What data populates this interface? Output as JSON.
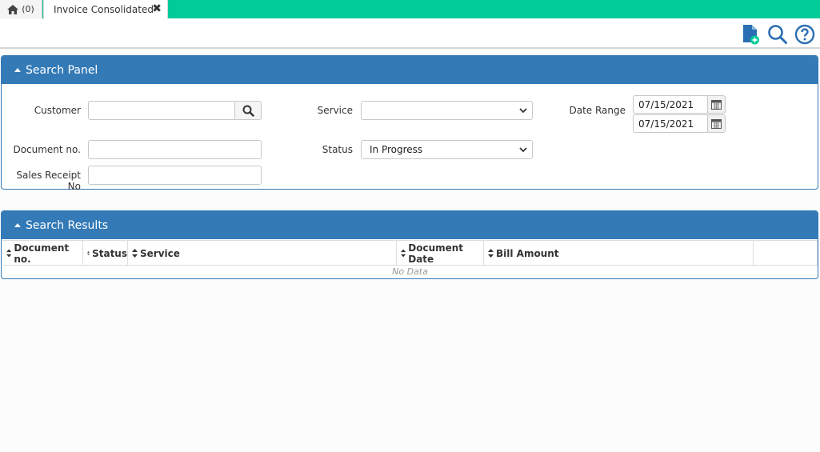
{
  "tabs": {
    "home_count": "(0)",
    "active_label": "Invoice Consolidated",
    "close_glyph": "✖"
  },
  "toolbar": {
    "icons": [
      "new-document-icon",
      "search-icon",
      "help-icon"
    ]
  },
  "search_panel": {
    "title": "Search Panel",
    "customer_label": "Customer",
    "customer_value": "",
    "document_no_label": "Document no.",
    "document_no_value": "",
    "sales_receipt_label": "Sales Receipt No",
    "sales_receipt_value": "",
    "service_label": "Service",
    "service_value": "",
    "status_label": "Status",
    "status_value": "In Progress",
    "date_range_label": "Date Range",
    "date_from": "07/15/2021",
    "date_to": "07/15/2021"
  },
  "results_panel": {
    "title": "Search Results",
    "columns": [
      "Document no.",
      "Status",
      "Service",
      "Document Date",
      "Bill Amount",
      ""
    ],
    "empty_text": "No Data"
  },
  "colors": {
    "tab_bar": "#00cc99",
    "panel_header": "#337ab7",
    "icon_blue": "#1f6fb5"
  }
}
